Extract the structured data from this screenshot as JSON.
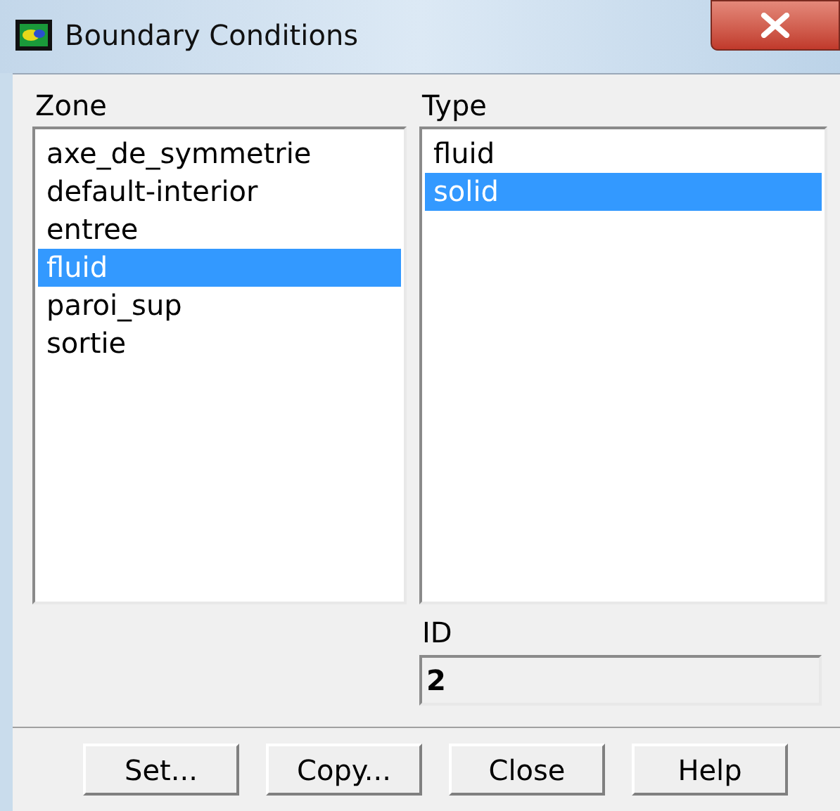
{
  "window": {
    "title": "Boundary Conditions"
  },
  "zone": {
    "label": "Zone",
    "items": [
      {
        "label": "axe_de_symmetrie",
        "selected": false
      },
      {
        "label": "default-interior",
        "selected": false
      },
      {
        "label": "entree",
        "selected": false
      },
      {
        "label": "fluid",
        "selected": true
      },
      {
        "label": "paroi_sup",
        "selected": false
      },
      {
        "label": "sortie",
        "selected": false
      }
    ]
  },
  "type": {
    "label": "Type",
    "items": [
      {
        "label": "fluid",
        "selected": false
      },
      {
        "label": "solid",
        "selected": true
      }
    ]
  },
  "id": {
    "label": "ID",
    "value": "2"
  },
  "buttons": [
    "Set...",
    "Copy...",
    "Close",
    "Help"
  ]
}
